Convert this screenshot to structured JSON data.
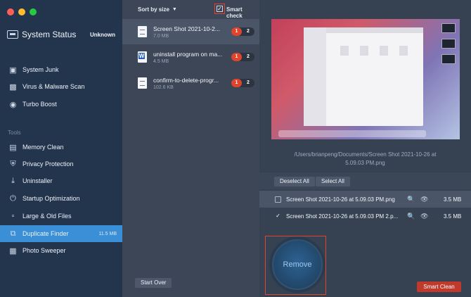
{
  "sidebar": {
    "status_title": "System Status",
    "status_value": "Unknown",
    "tools_label": "Tools",
    "items": [
      {
        "label": "System Junk",
        "icon": "monitor-icon"
      },
      {
        "label": "Virus & Malware Scan",
        "icon": "scan-icon"
      },
      {
        "label": "Turbo Boost",
        "icon": "turbo-icon"
      },
      {
        "label": "Memory Clean",
        "icon": "memory-icon"
      },
      {
        "label": "Privacy Protection",
        "icon": "shield-icon"
      },
      {
        "label": "Uninstaller",
        "icon": "uninstall-icon"
      },
      {
        "label": "Startup Optimization",
        "icon": "power-icon"
      },
      {
        "label": "Large & Old Files",
        "icon": "file-icon"
      },
      {
        "label": "Duplicate Finder",
        "icon": "duplicate-icon",
        "badge": "11.5 MB"
      },
      {
        "label": "Photo Sweeper",
        "icon": "photo-icon"
      }
    ]
  },
  "list": {
    "sort_label": "Sort by size",
    "smart_check_label": "Smart check",
    "smart_check_checked": true,
    "files": [
      {
        "name": "Screen Shot 2021-10-2...",
        "size": "7.0 MB",
        "dup_selected": "1",
        "dup_total": "2"
      },
      {
        "name": "uninstall program on ma...",
        "size": "4.5 MB",
        "dup_selected": "1",
        "dup_total": "2"
      },
      {
        "name": "confirm-to-delete-progr...",
        "size": "102.6 KB",
        "dup_selected": "1",
        "dup_total": "2"
      }
    ],
    "start_over_label": "Start Over"
  },
  "detail": {
    "path_line1": "/Users/brianpeng/Documents/Screen Shot 2021-10-26 at",
    "path_line2": "5.09.03 PM.png",
    "deselect_all_label": "Deselect All",
    "select_all_label": "Select All",
    "rows": [
      {
        "name": "Screen Shot 2021-10-26 at 5.09.03 PM.png",
        "size": "3.5 MB",
        "checked": false
      },
      {
        "name": "Screen Shot 2021-10-26 at 5.09.03 PM 2.p...",
        "size": "3.5 MB",
        "checked": true
      }
    ],
    "remove_label": "Remove",
    "smart_clean_label": "Smart Clean"
  },
  "colors": {
    "sidebar_bg": "#22354d",
    "active_item": "#3b8fd6",
    "accent_red": "#e0442d",
    "smart_clean_bg": "#c0392b"
  }
}
